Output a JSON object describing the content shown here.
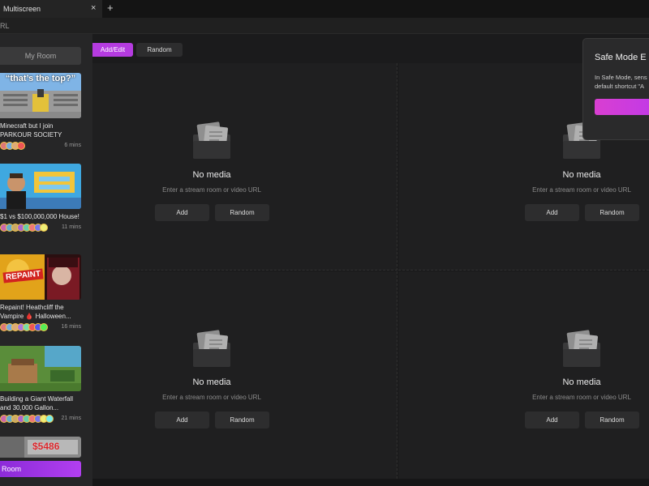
{
  "tab": {
    "title": "Multiscreen",
    "close": "×",
    "new_tab": "+"
  },
  "urlbar": {
    "text": "RL"
  },
  "sidebar": {
    "my_room": "My Room",
    "cards": [
      {
        "title_line1": "Minecraft but I join",
        "title_line2": "PARKOUR SOCIETY",
        "time": "6 mins",
        "thumb_caption": "“that’s the top?”"
      },
      {
        "title_line1": "$1 vs $100,000,000 House!",
        "title_line2": "",
        "time": "11 mins"
      },
      {
        "title_line1": "Repaint! Heathcliff the",
        "title_line2": "Vampire 🩸 Halloween...",
        "time": "16 mins",
        "thumb_caption": "REPAINT"
      },
      {
        "title_line1": "Building a Giant Waterfall",
        "title_line2": "and 30,000 Gallon...",
        "time": "21 mins"
      },
      {
        "thumb_caption": "$5486"
      }
    ],
    "room_button": "Room"
  },
  "toolbar": {
    "add_edit": "Add/Edit",
    "random": "Random"
  },
  "cells": [
    {
      "title": "No media",
      "subtitle": "Enter a stream room or video URL",
      "add": "Add",
      "random": "Random"
    },
    {
      "title": "No media",
      "subtitle": "Enter a stream room or video URL",
      "add": "Add",
      "random": "Random"
    },
    {
      "title": "No media",
      "subtitle": "Enter a stream room or video URL",
      "add": "Add",
      "random": "Random"
    },
    {
      "title": "No media",
      "subtitle": "Enter a stream room or video URL",
      "add": "Add",
      "random": "Random"
    }
  ],
  "popup": {
    "title": "Safe Mode E",
    "body_line1": "In Safe Mode, sens",
    "body_line2": "default shortcut \"A"
  },
  "colors": {
    "accent": "#b53be0",
    "background": "#161617",
    "cell": "#1f1f20"
  },
  "icons": {
    "empty_media": "media-folder-icon"
  }
}
